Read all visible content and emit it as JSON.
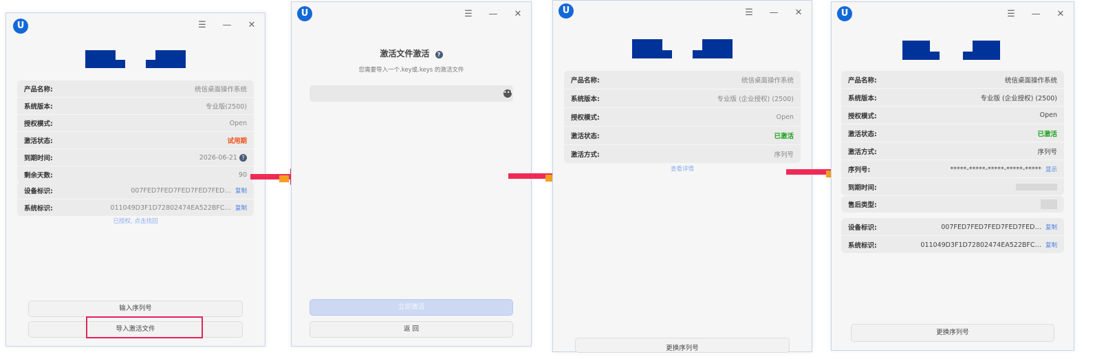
{
  "win1": {
    "rows": [
      {
        "k": "产品名称:",
        "v": "统信桌面操作系统"
      },
      {
        "k": "系统版本:",
        "v": "专业版(2500)"
      },
      {
        "k": "授权模式:",
        "v": "Open"
      },
      {
        "k": "激活状态:",
        "v": "试用期"
      },
      {
        "k": "到期时间:",
        "v": "2026-06-21"
      },
      {
        "k": "剩余天数:",
        "v": "90"
      }
    ],
    "ids": [
      {
        "k": "设备标识:",
        "v": "007FED7FED7FED7FED7FED…",
        "c": "复制"
      },
      {
        "k": "系统标识:",
        "v": "011049D3F1D72802474EA522BFC…",
        "c": "复制"
      }
    ],
    "link": "已授权, 点击找回",
    "btn_serial": "输入序列号",
    "btn_import": "导入激活文件"
  },
  "win2": {
    "title": "激活文件激活",
    "subtitle": "您需要导入一个.key或.keys 的激活文件",
    "btn_activate": "立即激活",
    "btn_back": "返 回"
  },
  "win3": {
    "rows": [
      {
        "k": "产品名称:",
        "v": "统信桌面操作系统"
      },
      {
        "k": "系统版本:",
        "v": "专业版 (企业授权) (2500)"
      },
      {
        "k": "授权模式:",
        "v": "Open"
      },
      {
        "k": "激活状态:",
        "v": "已激活"
      },
      {
        "k": "激活方式:",
        "v": "序列号"
      }
    ],
    "link": "查看详情",
    "btn": "更换序列号"
  },
  "win4": {
    "rows": [
      {
        "k": "产品名称:",
        "v": "统信桌面操作系统"
      },
      {
        "k": "系统版本:",
        "v": "专业版 (企业授权) (2500)"
      },
      {
        "k": "授权模式:",
        "v": "Open"
      },
      {
        "k": "激活状态:",
        "v": "已激活"
      },
      {
        "k": "激活方式:",
        "v": "序列号"
      },
      {
        "k": "序列号:",
        "v": "*****-*****-*****-*****-*****",
        "c": "显示"
      },
      {
        "k": "到期时间:",
        "v": ""
      }
    ],
    "after": {
      "k": "售后类型:",
      "v": ""
    },
    "ids": [
      {
        "k": "设备标识:",
        "v": "007FED7FED7FED7FED7FED…",
        "c": "复制"
      },
      {
        "k": "系统标识:",
        "v": "011049D3F1D72802474EA522BFC…",
        "c": "复制"
      }
    ],
    "btn": "更换序列号"
  },
  "colors": {
    "trial": "#f0541e",
    "active": "#1ea11e",
    "brand": "#003399",
    "arrow": "#ef2b55"
  },
  "icons": [
    "app-logo-icon",
    "menu-icon",
    "minimize-icon",
    "close-icon",
    "help-icon",
    "more-icon",
    "arrow-icon"
  ]
}
